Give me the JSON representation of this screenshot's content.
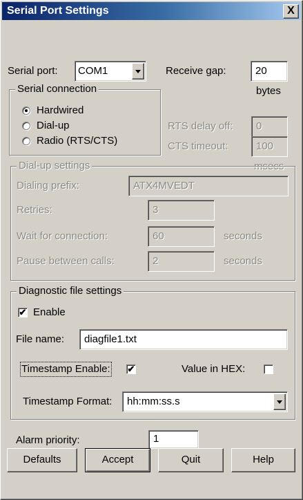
{
  "window": {
    "title": "Serial Port Settings",
    "close_glyph": "X"
  },
  "serial_port": {
    "label": "Serial port:",
    "value": "COM1"
  },
  "receive_gap": {
    "label": "Receive gap:",
    "value": "20",
    "unit": "bytes"
  },
  "serial_connection": {
    "legend": "Serial connection",
    "options": [
      {
        "label": "Hardwired",
        "selected": true
      },
      {
        "label": "Dial-up",
        "selected": false
      },
      {
        "label": "Radio (RTS/CTS)",
        "selected": false
      }
    ]
  },
  "rts_delay_off": {
    "label": "RTS delay off:",
    "value": "0"
  },
  "cts_timeout": {
    "label": "CTS timeout:",
    "value": "100",
    "unit": "msecs"
  },
  "dialup": {
    "legend": "Dial-up settings",
    "dialing_prefix": {
      "label": "Dialing prefix:",
      "value": "ATX4MVEDT"
    },
    "retries": {
      "label": "Retries:",
      "value": "3"
    },
    "wait": {
      "label": "Wait for connection:",
      "value": "60",
      "unit": "seconds"
    },
    "pause": {
      "label": "Pause between calls:",
      "value": "2",
      "unit": "seconds"
    }
  },
  "diagnostic": {
    "legend": "Diagnostic file settings",
    "enable": {
      "label": "Enable",
      "checked": true
    },
    "file_name": {
      "label": "File name:",
      "value": "diagfile1.txt"
    },
    "timestamp_enable": {
      "label": "Timestamp Enable:",
      "checked": true
    },
    "value_in_hex": {
      "label": "Value in HEX:",
      "checked": false
    },
    "timestamp_format": {
      "label": "Timestamp Format:",
      "value": "hh:mm:ss.s"
    }
  },
  "alarm_priority": {
    "label": "Alarm priority:",
    "value": "1"
  },
  "buttons": {
    "defaults": "Defaults",
    "accept": "Accept",
    "quit": "Quit",
    "help": "Help"
  },
  "check_glyph": "✔"
}
